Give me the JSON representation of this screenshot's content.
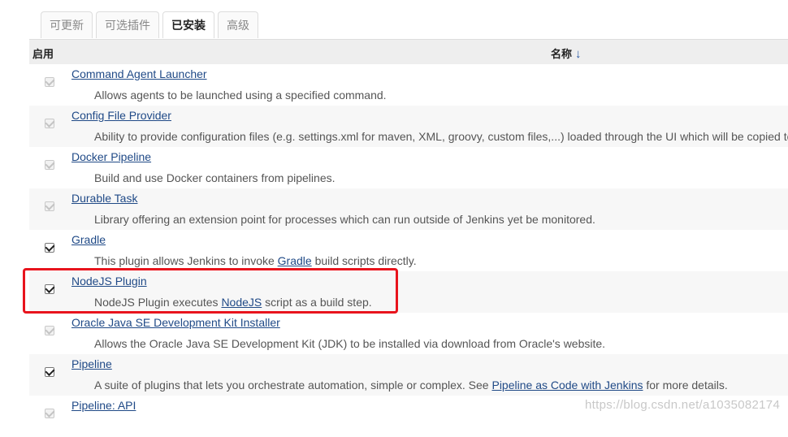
{
  "tabs": [
    {
      "label": "可更新"
    },
    {
      "label": "可选插件"
    },
    {
      "label": "已安装"
    },
    {
      "label": "高级"
    }
  ],
  "table": {
    "col_enabled": "启用",
    "col_name": "名称",
    "sort_indicator": "↓"
  },
  "plugins": [
    {
      "name": "Command Agent Launcher",
      "desc_pre": "Allows agents to be launched using a specified command.",
      "checked": true,
      "editable": false
    },
    {
      "name": "Config File Provider",
      "desc_pre": "Ability to provide configuration files (e.g. settings.xml for maven, XML, groovy, custom files,...) loaded through the UI which will be copied to",
      "checked": true,
      "editable": false
    },
    {
      "name": "Docker Pipeline",
      "desc_pre": "Build and use Docker containers from pipelines.",
      "checked": true,
      "editable": false
    },
    {
      "name": "Durable Task",
      "desc_pre": "Library offering an extension point for processes which can run outside of Jenkins yet be monitored.",
      "checked": true,
      "editable": false
    },
    {
      "name": "Gradle",
      "desc_pre": "This plugin allows Jenkins to invoke ",
      "desc_link": "Gradle",
      "desc_post": " build scripts directly.",
      "checked": true,
      "editable": true
    },
    {
      "name": "NodeJS Plugin",
      "desc_pre": "NodeJS Plugin executes ",
      "desc_link": "NodeJS",
      "desc_post": " script as a build step.",
      "checked": true,
      "editable": true
    },
    {
      "name": "Oracle Java SE Development Kit Installer",
      "desc_pre": "Allows the Oracle Java SE Development Kit (JDK) to be installed via download from Oracle's website.",
      "checked": true,
      "editable": false
    },
    {
      "name": "Pipeline",
      "desc_pre": "A suite of plugins that lets you orchestrate automation, simple or complex. See ",
      "desc_link": "Pipeline as Code with Jenkins",
      "desc_post": " for more details.",
      "checked": true,
      "editable": true
    },
    {
      "name": "Pipeline: API",
      "desc_pre": "",
      "checked": true,
      "editable": false
    }
  ],
  "watermark": "https://blog.csdn.net/a1035082174",
  "colors": {
    "link": "#204a87",
    "highlight": "#e8141d"
  }
}
